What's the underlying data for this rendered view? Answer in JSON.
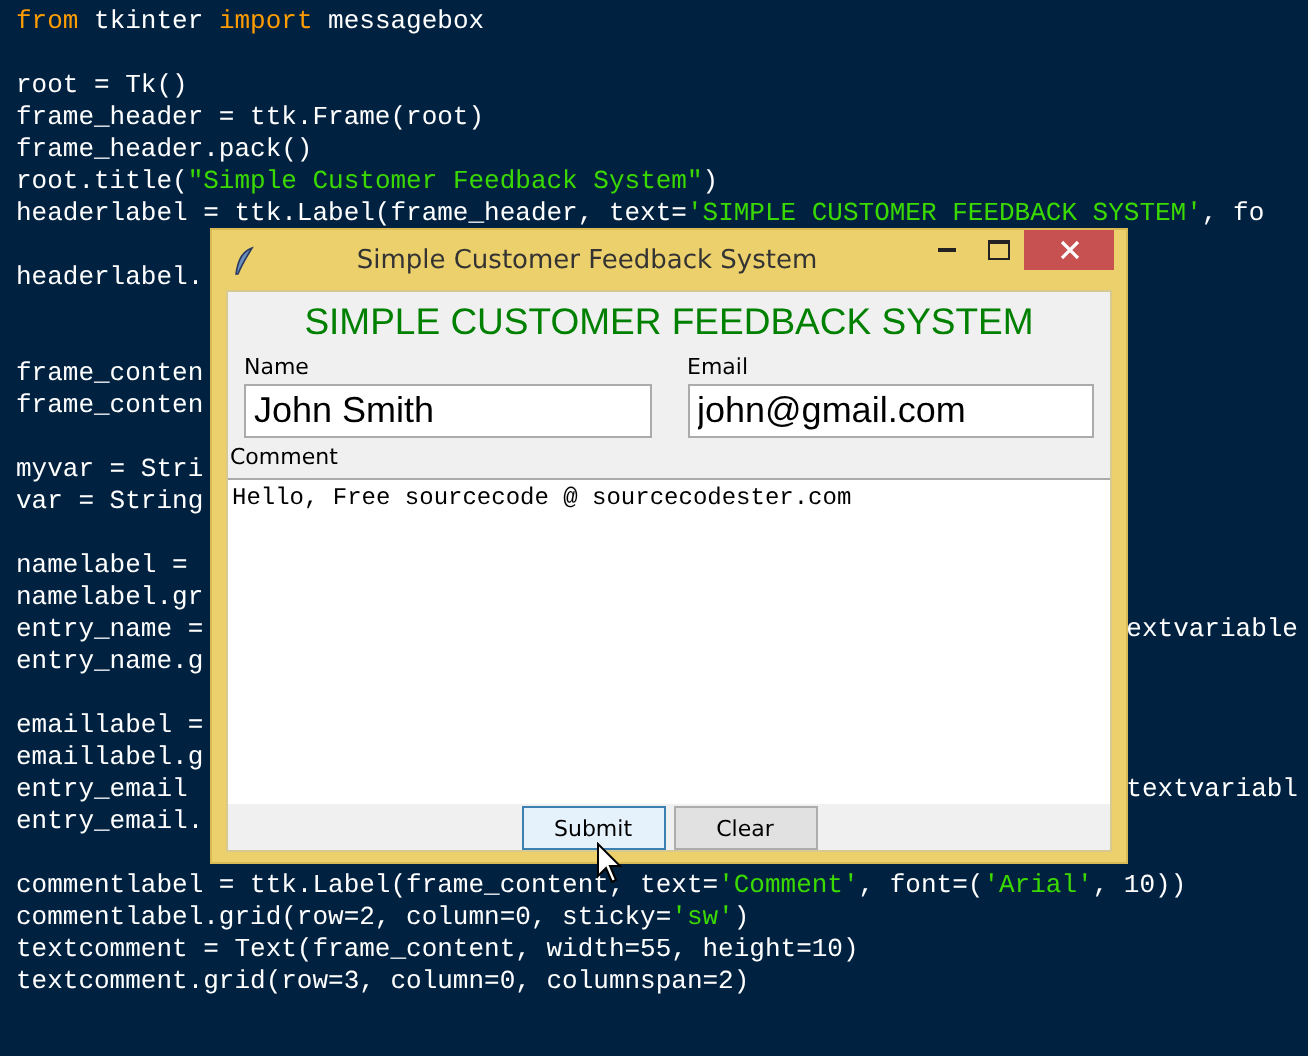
{
  "editor": {
    "lines": [
      {
        "kind": "code",
        "parts": [
          {
            "text": "from",
            "kind": "keyword"
          },
          {
            "text": " tkinter ",
            "kind": "plain"
          },
          {
            "text": "import",
            "kind": "keyword"
          },
          {
            "text": " messagebox",
            "kind": "plain"
          }
        ]
      },
      {
        "kind": "blank"
      },
      {
        "kind": "code",
        "parts": [
          {
            "text": "root = Tk()",
            "kind": "plain"
          }
        ]
      },
      {
        "kind": "code",
        "parts": [
          {
            "text": "frame_header = ttk.Frame(root)",
            "kind": "plain"
          }
        ]
      },
      {
        "kind": "code",
        "parts": [
          {
            "text": "frame_header.pack()",
            "kind": "plain"
          }
        ]
      },
      {
        "kind": "code",
        "parts": [
          {
            "text": "root.title(",
            "kind": "plain"
          },
          {
            "text": "\"Simple Customer Feedback System\"",
            "kind": "string"
          },
          {
            "text": ")",
            "kind": "plain"
          }
        ]
      },
      {
        "kind": "code",
        "parts": [
          {
            "text": "headerlabel = ttk.Label(frame_header, text=",
            "kind": "plain"
          },
          {
            "text": "'SIMPLE CUSTOMER FEEDBACK SYSTEM'",
            "kind": "string"
          },
          {
            "text": ", fo",
            "kind": "plain"
          }
        ]
      },
      {
        "kind": "blank"
      },
      {
        "kind": "code",
        "parts": [
          {
            "text": "headerlabel.",
            "kind": "plain"
          }
        ]
      },
      {
        "kind": "blank"
      },
      {
        "kind": "blank"
      },
      {
        "kind": "code",
        "parts": [
          {
            "text": "frame_conten",
            "kind": "plain"
          }
        ]
      },
      {
        "kind": "code",
        "parts": [
          {
            "text": "frame_conten",
            "kind": "plain"
          }
        ]
      },
      {
        "kind": "blank"
      },
      {
        "kind": "code",
        "parts": [
          {
            "text": "myvar = Stri",
            "kind": "plain"
          }
        ]
      },
      {
        "kind": "code",
        "parts": [
          {
            "text": "var = String",
            "kind": "plain"
          }
        ]
      },
      {
        "kind": "blank"
      },
      {
        "kind": "code",
        "parts": [
          {
            "text": "namelabel =",
            "kind": "plain"
          }
        ]
      },
      {
        "kind": "code",
        "parts": [
          {
            "text": "namelabel.gr",
            "kind": "plain"
          }
        ]
      },
      {
        "kind": "code",
        "parts": [
          {
            "text": "entry_name =",
            "kind": "plain"
          }
        ],
        "right": "extvariable"
      },
      {
        "kind": "code",
        "parts": [
          {
            "text": "entry_name.g",
            "kind": "plain"
          }
        ]
      },
      {
        "kind": "blank"
      },
      {
        "kind": "code",
        "parts": [
          {
            "text": "emaillabel =",
            "kind": "plain"
          }
        ]
      },
      {
        "kind": "code",
        "parts": [
          {
            "text": "emaillabel.g",
            "kind": "plain"
          }
        ]
      },
      {
        "kind": "code",
        "parts": [
          {
            "text": "entry_email",
            "kind": "plain"
          }
        ],
        "right": "textvariabl"
      },
      {
        "kind": "code",
        "parts": [
          {
            "text": "entry_email.",
            "kind": "plain"
          }
        ]
      },
      {
        "kind": "blank"
      },
      {
        "kind": "code",
        "parts": [
          {
            "text": "commentlabel = ttk.Label(frame_content, text=",
            "kind": "plain"
          },
          {
            "text": "'Comment'",
            "kind": "string"
          },
          {
            "text": ", font=(",
            "kind": "plain"
          },
          {
            "text": "'Arial'",
            "kind": "string"
          },
          {
            "text": ", 10))",
            "kind": "plain"
          }
        ]
      },
      {
        "kind": "code",
        "parts": [
          {
            "text": "commentlabel.grid(row=2, column=0, sticky=",
            "kind": "plain"
          },
          {
            "text": "'sw'",
            "kind": "string"
          },
          {
            "text": ")",
            "kind": "plain"
          }
        ]
      },
      {
        "kind": "code",
        "parts": [
          {
            "text": "textcomment = Text(frame_content, width=55, height=10)",
            "kind": "plain"
          }
        ]
      },
      {
        "kind": "code",
        "parts": [
          {
            "text": "textcomment.grid(row=3, column=0, columnspan=2)",
            "kind": "plain"
          }
        ]
      }
    ]
  },
  "window": {
    "title": "Simple Customer Feedback System",
    "header": "SIMPLE CUSTOMER FEEDBACK SYSTEM",
    "fields": [
      {
        "label": "Name",
        "value": "John Smith"
      },
      {
        "label": "Email",
        "value": "john@gmail.com"
      }
    ],
    "comment": {
      "label": "Comment",
      "value": "Hello, Free sourcecode @ sourcecodester.com"
    },
    "buttons": [
      {
        "label": "Submit",
        "selected": true
      },
      {
        "label": "Clear",
        "selected": false
      }
    ]
  }
}
